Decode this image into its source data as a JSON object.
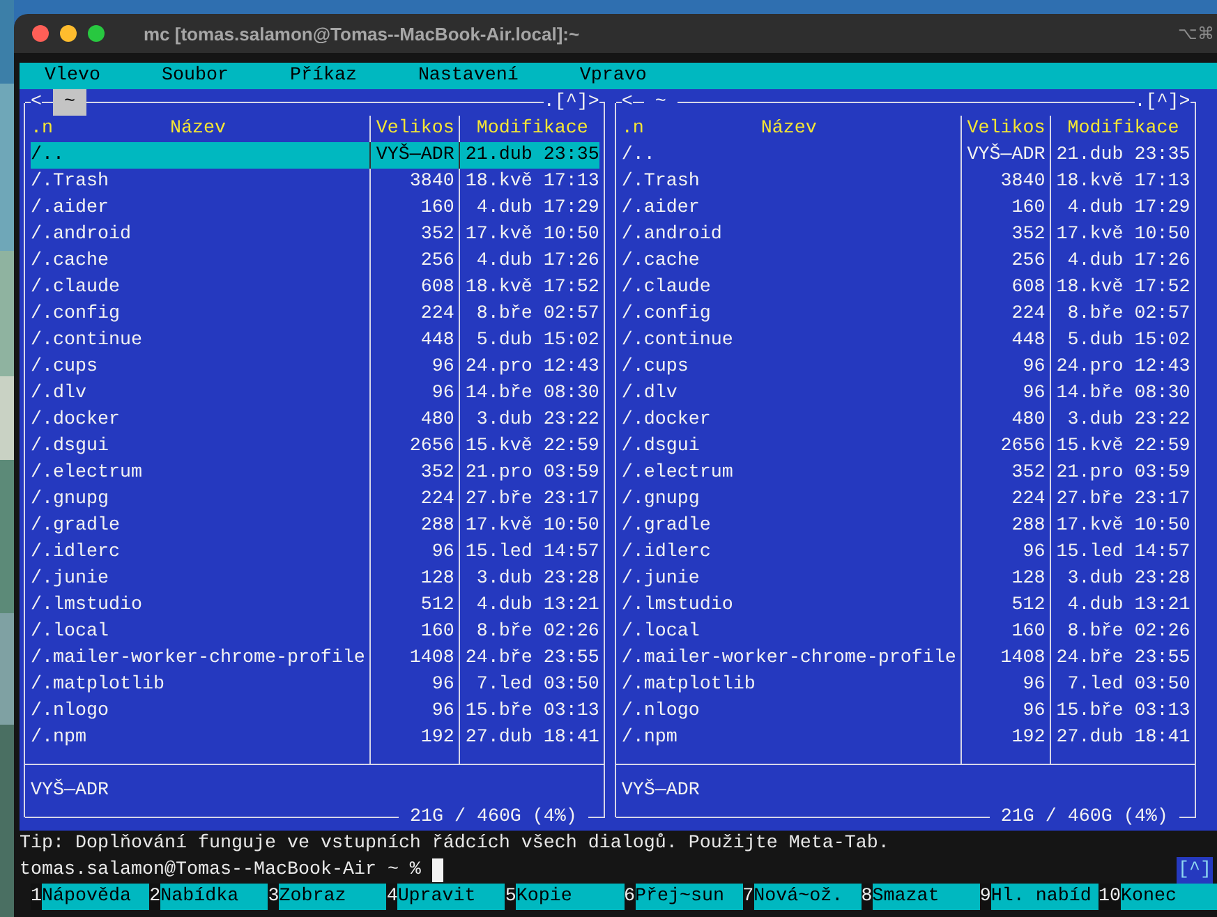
{
  "window": {
    "title": "mc [tomas.salamon@Tomas--MacBook-Air.local]:~",
    "shortcut": "⌥⌘"
  },
  "menu": [
    "Vlevo",
    "Soubor",
    "Příkaz",
    "Nastavení",
    "Vpravo"
  ],
  "panels": [
    {
      "active": true,
      "history_back": "<",
      "path": "~",
      "hotlist": ".[^]",
      "history_forward": ">",
      "sort_indicator": ".n",
      "columns": [
        "Název",
        "Velikos",
        "Modifikace"
      ],
      "files": [
        {
          "name": "/..",
          "size": "VYŠ—ADR",
          "modified": "21.dub 23:35",
          "selected": true
        },
        {
          "name": "/.Trash",
          "size": "3840",
          "modified": "18.kvě 17:13",
          "selected": false
        },
        {
          "name": "/.aider",
          "size": "160",
          "modified": "4.dub 17:29",
          "selected": false
        },
        {
          "name": "/.android",
          "size": "352",
          "modified": "17.kvě 10:50",
          "selected": false
        },
        {
          "name": "/.cache",
          "size": "256",
          "modified": "4.dub 17:26",
          "selected": false
        },
        {
          "name": "/.claude",
          "size": "608",
          "modified": "18.kvě 17:52",
          "selected": false
        },
        {
          "name": "/.config",
          "size": "224",
          "modified": "8.bře 02:57",
          "selected": false
        },
        {
          "name": "/.continue",
          "size": "448",
          "modified": "5.dub 15:02",
          "selected": false
        },
        {
          "name": "/.cups",
          "size": "96",
          "modified": "24.pro 12:43",
          "selected": false
        },
        {
          "name": "/.dlv",
          "size": "96",
          "modified": "14.bře 08:30",
          "selected": false
        },
        {
          "name": "/.docker",
          "size": "480",
          "modified": "3.dub 23:22",
          "selected": false
        },
        {
          "name": "/.dsgui",
          "size": "2656",
          "modified": "15.kvě 22:59",
          "selected": false
        },
        {
          "name": "/.electrum",
          "size": "352",
          "modified": "21.pro 03:59",
          "selected": false
        },
        {
          "name": "/.gnupg",
          "size": "224",
          "modified": "27.bře 23:17",
          "selected": false
        },
        {
          "name": "/.gradle",
          "size": "288",
          "modified": "17.kvě 10:50",
          "selected": false
        },
        {
          "name": "/.idlerc",
          "size": "96",
          "modified": "15.led 14:57",
          "selected": false
        },
        {
          "name": "/.junie",
          "size": "128",
          "modified": "3.dub 23:28",
          "selected": false
        },
        {
          "name": "/.lmstudio",
          "size": "512",
          "modified": "4.dub 13:21",
          "selected": false
        },
        {
          "name": "/.local",
          "size": "160",
          "modified": "8.bře 02:26",
          "selected": false
        },
        {
          "name": "/.mailer-worker-chrome-profile",
          "size": "1408",
          "modified": "24.bře 23:55",
          "selected": false
        },
        {
          "name": "/.matplotlib",
          "size": "96",
          "modified": "7.led 03:50",
          "selected": false
        },
        {
          "name": "/.nlogo",
          "size": "96",
          "modified": "15.bře 03:13",
          "selected": false
        },
        {
          "name": "/.npm",
          "size": "192",
          "modified": "27.dub 18:41",
          "selected": false
        }
      ],
      "mini_status": "VYŠ—ADR",
      "disk_usage": "21G / 460G (4%)"
    },
    {
      "active": false,
      "history_back": "<",
      "path": "~",
      "hotlist": ".[^]",
      "history_forward": ">",
      "sort_indicator": ".n",
      "columns": [
        "Název",
        "Velikos",
        "Modifikace"
      ],
      "files": [
        {
          "name": "/..",
          "size": "VYŠ—ADR",
          "modified": "21.dub 23:35",
          "selected": false
        },
        {
          "name": "/.Trash",
          "size": "3840",
          "modified": "18.kvě 17:13",
          "selected": false
        },
        {
          "name": "/.aider",
          "size": "160",
          "modified": "4.dub 17:29",
          "selected": false
        },
        {
          "name": "/.android",
          "size": "352",
          "modified": "17.kvě 10:50",
          "selected": false
        },
        {
          "name": "/.cache",
          "size": "256",
          "modified": "4.dub 17:26",
          "selected": false
        },
        {
          "name": "/.claude",
          "size": "608",
          "modified": "18.kvě 17:52",
          "selected": false
        },
        {
          "name": "/.config",
          "size": "224",
          "modified": "8.bře 02:57",
          "selected": false
        },
        {
          "name": "/.continue",
          "size": "448",
          "modified": "5.dub 15:02",
          "selected": false
        },
        {
          "name": "/.cups",
          "size": "96",
          "modified": "24.pro 12:43",
          "selected": false
        },
        {
          "name": "/.dlv",
          "size": "96",
          "modified": "14.bře 08:30",
          "selected": false
        },
        {
          "name": "/.docker",
          "size": "480",
          "modified": "3.dub 23:22",
          "selected": false
        },
        {
          "name": "/.dsgui",
          "size": "2656",
          "modified": "15.kvě 22:59",
          "selected": false
        },
        {
          "name": "/.electrum",
          "size": "352",
          "modified": "21.pro 03:59",
          "selected": false
        },
        {
          "name": "/.gnupg",
          "size": "224",
          "modified": "27.bře 23:17",
          "selected": false
        },
        {
          "name": "/.gradle",
          "size": "288",
          "modified": "17.kvě 10:50",
          "selected": false
        },
        {
          "name": "/.idlerc",
          "size": "96",
          "modified": "15.led 14:57",
          "selected": false
        },
        {
          "name": "/.junie",
          "size": "128",
          "modified": "3.dub 23:28",
          "selected": false
        },
        {
          "name": "/.lmstudio",
          "size": "512",
          "modified": "4.dub 13:21",
          "selected": false
        },
        {
          "name": "/.local",
          "size": "160",
          "modified": "8.bře 02:26",
          "selected": false
        },
        {
          "name": "/.mailer-worker-chrome-profile",
          "size": "1408",
          "modified": "24.bře 23:55",
          "selected": false
        },
        {
          "name": "/.matplotlib",
          "size": "96",
          "modified": "7.led 03:50",
          "selected": false
        },
        {
          "name": "/.nlogo",
          "size": "96",
          "modified": "15.bře 03:13",
          "selected": false
        },
        {
          "name": "/.npm",
          "size": "192",
          "modified": "27.dub 18:41",
          "selected": false
        }
      ],
      "mini_status": "VYŠ—ADR",
      "disk_usage": "21G / 460G (4%)"
    }
  ],
  "tip": "Tip: Doplňování funguje ve vstupních řádcích všech dialogů. Použijte Meta-Tab.",
  "prompt": {
    "text": "tomas.salamon@Tomas--MacBook-Air ~ %",
    "indicator": "[^]"
  },
  "function_keys": [
    {
      "key": "1",
      "label": "Nápověda"
    },
    {
      "key": "2",
      "label": "Nabídka"
    },
    {
      "key": "3",
      "label": "Zobraz"
    },
    {
      "key": "4",
      "label": "Upravit"
    },
    {
      "key": "5",
      "label": "Kopie"
    },
    {
      "key": "6",
      "label": "Přej~sun"
    },
    {
      "key": "7",
      "label": "Nová~ož."
    },
    {
      "key": "8",
      "label": "Smazat"
    },
    {
      "key": "9",
      "label": "Hl. nabíd"
    },
    {
      "key": "10",
      "label": "Konec"
    }
  ]
}
